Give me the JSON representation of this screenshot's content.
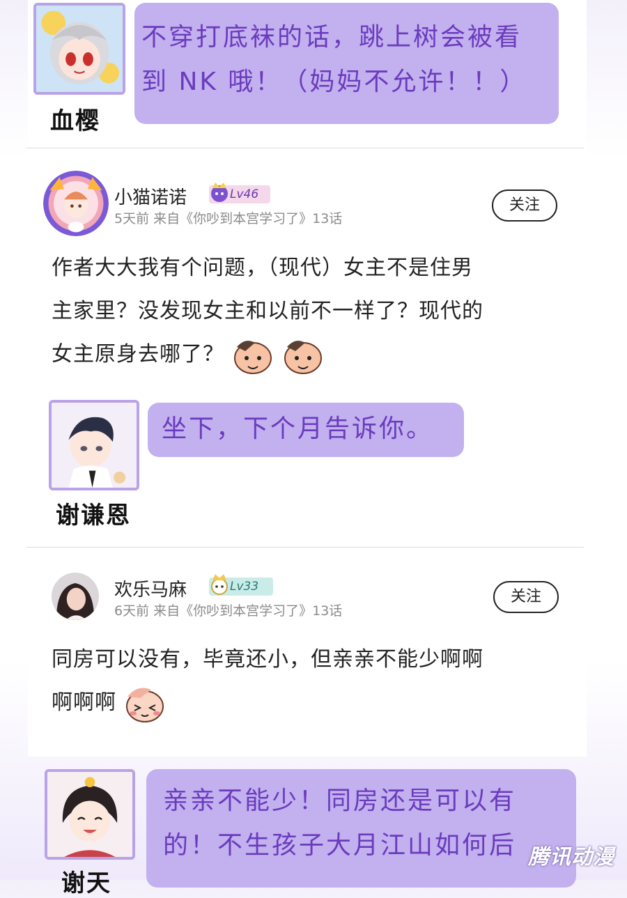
{
  "colors": {
    "bubble_bg": "#c2b0ef",
    "bubble_text": "#6a3bbd",
    "avatar_frame": "#b9a2e6",
    "meta_text": "#8a8a8a"
  },
  "replies": [
    {
      "name": "血樱",
      "text": "不穿打底袜的话，跳上树会被看到 NK 哦！（妈妈不允许！！）",
      "line1": "不穿打底袜的话，跳上树会被看",
      "line2": "到 NK 哦！（妈妈不允许！！）"
    },
    {
      "name": "谢谦恩",
      "text": "坐下，下个月告诉你。"
    },
    {
      "name": "谢天",
      "line1": "亲亲不能少！同房还是可以有",
      "line2": "的！不生孩子大月江山如何后"
    }
  ],
  "comments": [
    {
      "user": "小猫诺诺",
      "level": "Lv46",
      "meta": "5天前  来自《你吵到本宫学习了》13话",
      "follow": "关注",
      "line1": "作者大大我有个问题，（现代）女主不是住男",
      "line2": "主家里？没发现女主和以前不一样了？现代的",
      "line3": "女主原身去哪了？",
      "emoji": "dog-face-emoji"
    },
    {
      "user": "欢乐马麻",
      "level": "Lv33",
      "meta": "6天前  来自《你吵到本宫学习了》13话",
      "follow": "关注",
      "line1": "同房可以没有，毕竟还小，但亲亲不能少啊啊",
      "line2": "啊啊啊",
      "emoji": "happy-blush-emoji"
    }
  ],
  "watermark": "腾讯动漫"
}
